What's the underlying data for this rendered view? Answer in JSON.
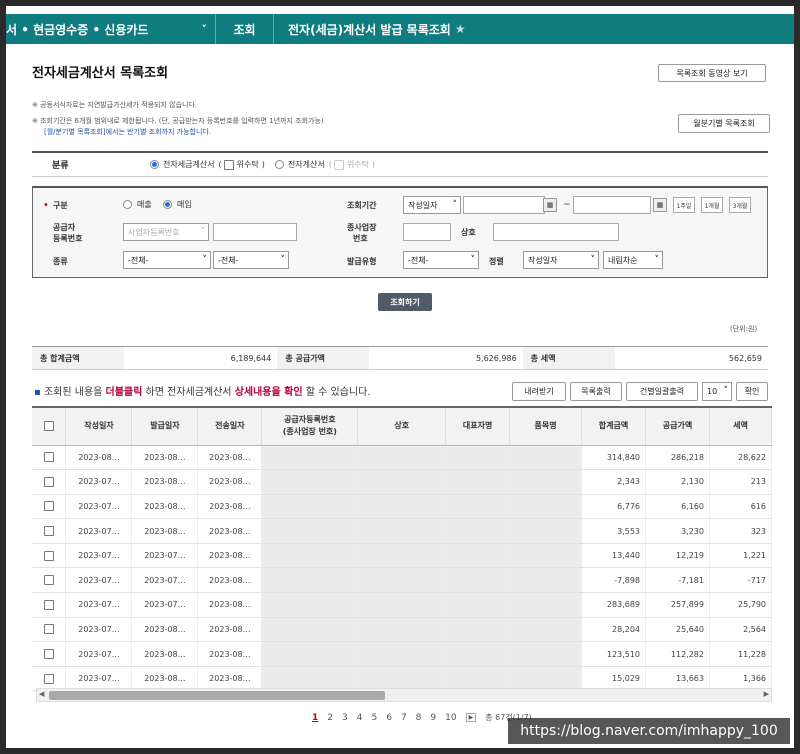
{
  "topnav": {
    "menu": "서 • 현금영수증 • 신용카드",
    "crumb1": "조회",
    "crumb2": "전자(세금)계산서 발급 목록조회"
  },
  "page": {
    "title": "전자세금계산서 목록조회",
    "video_button": "목록조회 동영상 보기",
    "half_button": "월분기별 목록조회",
    "note1": "※ 공동서식자료는 지연발급가산세가 적용되지 않습니다.",
    "note2": "※ 조회기간은 6개월 범위내로 제한됩니다. (단, 공급받는자 등록번호를 입력하면 1년까지 조회가능)",
    "note3": "[월/분기별 목록조회]에서는 반기별 조회까지 가능합니다."
  },
  "category": {
    "label": "분류",
    "opt1": "전자세금계산서",
    "opt1_sub": "위수탁",
    "opt2": "전자계산서",
    "opt2_sub": "위수탁"
  },
  "search": {
    "gubun_label": "구분",
    "sale": "매출",
    "purchase": "매입",
    "period_label": "조회기간",
    "period_select": "작성일자",
    "tilde": "~",
    "btn_1w": "1주일",
    "btn_1m": "1개월",
    "btn_3m": "3개월",
    "supplier_label_1": "공급자",
    "supplier_label_2": "등록번호",
    "supplier_select": "사업자등록번호",
    "branch_label_1": "종사업장",
    "branch_label_2": "번호",
    "company_label": "상호",
    "kind_label": "종류",
    "kind1": "-전체-",
    "kind2": "-전체-",
    "issue_label": "발급유형",
    "issue_select": "-전체-",
    "sort_label": "정렬",
    "sort_field": "작성일자",
    "sort_order": "내림차순",
    "submit": "조회하기"
  },
  "unit": "(단위:원)",
  "totals": {
    "sum_label": "총 합계금액",
    "sum_value": "6,189,644",
    "supply_label": "총 공급가액",
    "supply_value": "5,626,986",
    "tax_label": "총 세액",
    "tax_value": "562,659"
  },
  "info": {
    "pre": " 조회된 내용을 ",
    "dbl": "더블클릭",
    "mid": " 하면 전자세금계산서 ",
    "detail": "상세내용을 확인",
    "post": " 할 수 있습니다."
  },
  "actions": {
    "download": "내려받기",
    "print_list": "목록출력",
    "bulk_print": "건별일괄출력",
    "page_size": "10",
    "confirm": "확인"
  },
  "table": {
    "headers": [
      "작성일자",
      "발급일자",
      "전송일자",
      "공급자등록번호",
      "(종사업장 번호)",
      "상호",
      "대표자명",
      "품목명",
      "합계금액",
      "공급가액",
      "세액"
    ],
    "rows": [
      [
        "2023-08…",
        "2023-08…",
        "2023-08…",
        "314,840",
        "286,218",
        "28,622"
      ],
      [
        "2023-07…",
        "2023-08…",
        "2023-08…",
        "2,343",
        "2,130",
        "213"
      ],
      [
        "2023-07…",
        "2023-08…",
        "2023-08…",
        "6,776",
        "6,160",
        "616"
      ],
      [
        "2023-07…",
        "2023-08…",
        "2023-08…",
        "3,553",
        "3,230",
        "323"
      ],
      [
        "2023-07…",
        "2023-07…",
        "2023-08…",
        "13,440",
        "12,219",
        "1,221"
      ],
      [
        "2023-07…",
        "2023-07…",
        "2023-08…",
        "-7,898",
        "-7,181",
        "-717"
      ],
      [
        "2023-07…",
        "2023-07…",
        "2023-08…",
        "283,689",
        "257,899",
        "25,790"
      ],
      [
        "2023-07…",
        "2023-08…",
        "2023-08…",
        "28,204",
        "25,640",
        "2,564"
      ],
      [
        "2023-07…",
        "2023-08…",
        "2023-08…",
        "123,510",
        "112,282",
        "11,228"
      ],
      [
        "2023-07…",
        "2023-08…",
        "2023-08…",
        "15,029",
        "13,663",
        "1,366"
      ]
    ]
  },
  "pager": {
    "pages": [
      "1",
      "2",
      "3",
      "4",
      "5",
      "6",
      "7",
      "8",
      "9",
      "10"
    ],
    "total": "총 67건(1/7)"
  },
  "watermark": "https://blog.naver.com/imhappy_100"
}
